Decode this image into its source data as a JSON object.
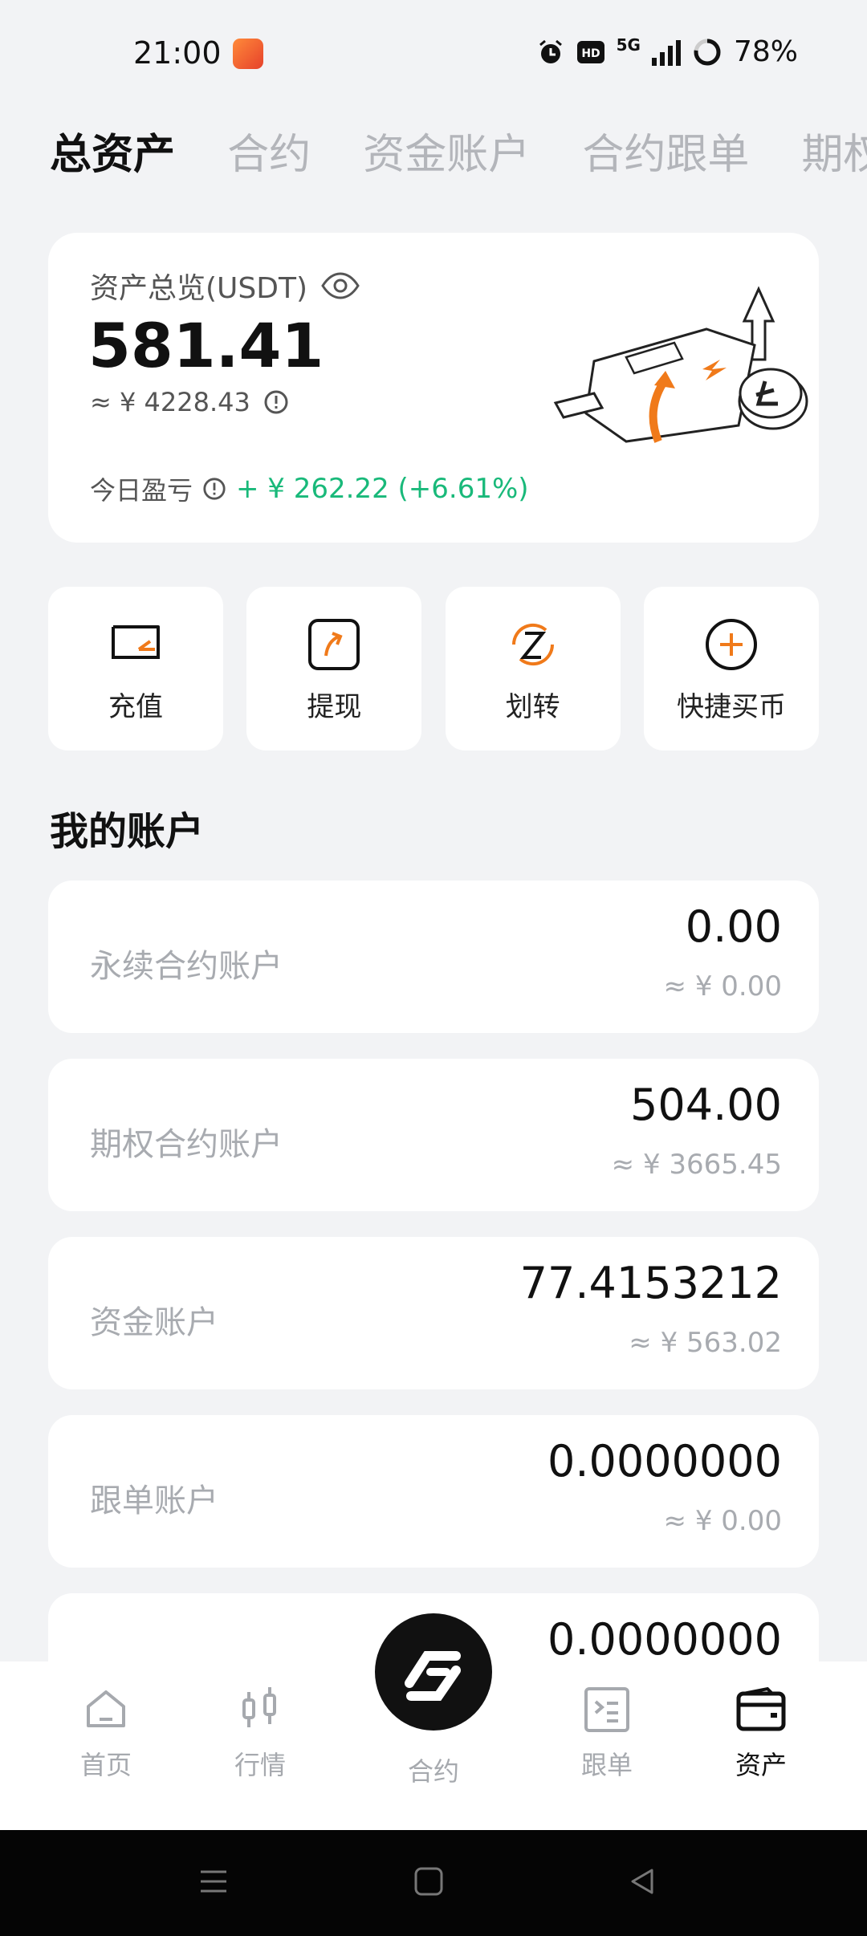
{
  "status_bar": {
    "time": "21:00",
    "network": "5G",
    "battery": "78%"
  },
  "tabs": [
    {
      "label": "总资产",
      "active": true
    },
    {
      "label": "合约",
      "active": false
    },
    {
      "label": "资金账户",
      "active": false
    },
    {
      "label": "合约跟单",
      "active": false
    },
    {
      "label": "期权",
      "active": false
    }
  ],
  "overview": {
    "label": "资产总览(USDT)",
    "total": "581.41",
    "fiat": "≈ ¥ 4228.43",
    "pnl_label": "今日盈亏",
    "pnl_value": "+ ¥ 262.22 (+6.61%)"
  },
  "actions": [
    {
      "label": "充值",
      "icon": "deposit-icon"
    },
    {
      "label": "提现",
      "icon": "withdraw-icon"
    },
    {
      "label": "划转",
      "icon": "transfer-icon"
    },
    {
      "label": "快捷买币",
      "icon": "quick-buy-icon"
    }
  ],
  "accounts_section": {
    "title": "我的账户",
    "items": [
      {
        "name": "永续合约账户",
        "amount": "0.00",
        "fiat": "≈ ¥ 0.00"
      },
      {
        "name": "期权合约账户",
        "amount": "504.00",
        "fiat": "≈ ¥ 3665.45"
      },
      {
        "name": "资金账户",
        "amount": "77.4153212",
        "fiat": "≈ ¥ 563.02"
      },
      {
        "name": "跟单账户",
        "amount": "0.0000000",
        "fiat": "≈ ¥ 0.00"
      },
      {
        "name": "",
        "amount": "0.0000000",
        "fiat": ""
      }
    ]
  },
  "bottom_nav": [
    {
      "label": "首页",
      "icon": "home-icon",
      "active": false
    },
    {
      "label": "行情",
      "icon": "candlestick-icon",
      "active": false
    },
    {
      "label": "合约",
      "icon": "contract-logo-icon",
      "active": false
    },
    {
      "label": "跟单",
      "icon": "copy-trade-icon",
      "active": false
    },
    {
      "label": "资产",
      "icon": "wallet-icon",
      "active": true
    }
  ],
  "colors": {
    "accent_orange": "#f07a1a",
    "profit_green": "#19b97a",
    "background": "#f2f3f5"
  }
}
